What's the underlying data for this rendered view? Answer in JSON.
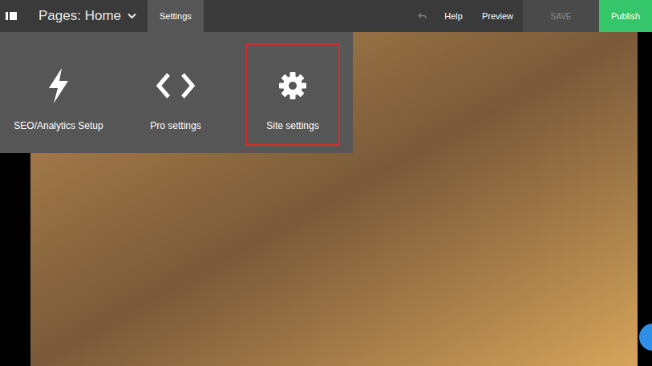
{
  "top_bar": {
    "page_selector": "Pages: Home",
    "tabs": [
      {
        "label": "Settings",
        "selected": true
      }
    ],
    "undo": {
      "disabled": true
    },
    "help": "Help",
    "preview": "Preview",
    "save": {
      "label": "SAVE",
      "disabled": true
    },
    "publish": "Publish"
  },
  "settings_menu": {
    "items": [
      {
        "label": "SEO/Analytics Setup",
        "kind": "bolt",
        "highlighted": false
      },
      {
        "label": "Pro settings",
        "kind": "code",
        "highlighted": false
      },
      {
        "label": "Site settings",
        "kind": "gear",
        "highlighted": true
      }
    ]
  }
}
